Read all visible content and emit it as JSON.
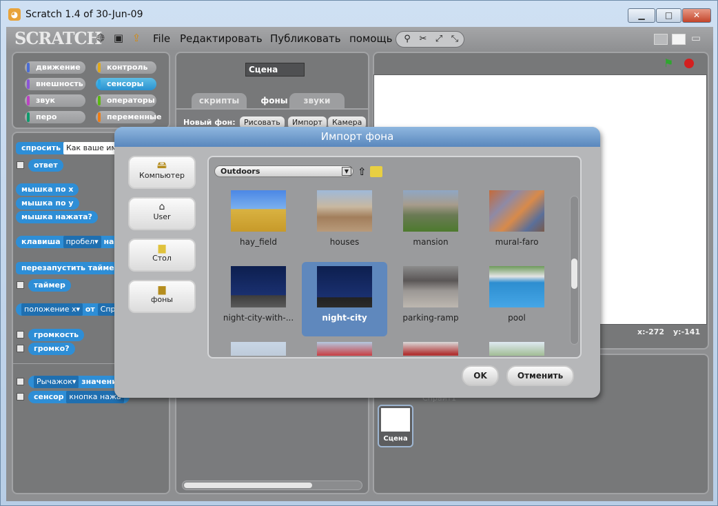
{
  "window": {
    "title": "Scratch 1.4 of 30-Jun-09",
    "minimize": "▁",
    "maximize": "□",
    "close": "✕"
  },
  "menubar": {
    "logo": "SCRATCH",
    "items": [
      "File",
      "Редактировать",
      "Публиковать",
      "помощь"
    ],
    "icons": [
      "globe-icon",
      "save-icon",
      "share-icon"
    ]
  },
  "categories": [
    {
      "label": "движение",
      "color": "#4a6cd4"
    },
    {
      "label": "контроль",
      "color": "#e1a91a"
    },
    {
      "label": "внешность",
      "color": "#8a55d7"
    },
    {
      "label": "сенсоры",
      "color": "#2ca5e2",
      "selected": true
    },
    {
      "label": "звук",
      "color": "#bb42c3"
    },
    {
      "label": "операторы",
      "color": "#5cb712"
    },
    {
      "label": "перо",
      "color": "#0e9a6c"
    },
    {
      "label": "переменные",
      "color": "#ee7d16"
    }
  ],
  "blocks": {
    "ask": "спросить",
    "ask_value": "Как ваше имя?",
    "answer": "ответ",
    "mouse_x": "мышка по x",
    "mouse_y": "мышка по y",
    "mouse_down": "мышка нажата?",
    "key": "клавиша",
    "key_value": "пробел",
    "key_suffix": "наж",
    "reset_timer": "перезапустить таймер",
    "timer": "таймер",
    "position": "положение x",
    "of": "от",
    "of_target": "Спр",
    "loudness": "громкость",
    "loud": "громко?",
    "slider": "Рычажок",
    "value": "значение",
    "sensor": "сенсор",
    "sensor_value": "кнопка нажа"
  },
  "middle": {
    "name": "Сцена",
    "tabs": [
      "скрипты",
      "фоны",
      "звуки"
    ],
    "new_bg": "Новый фон:",
    "paint": "Рисовать",
    "import": "Импорт",
    "camera": "Камера"
  },
  "stage": {
    "x_label": "x:",
    "x_value": "-272",
    "y_label": "y:",
    "y_value": "-141"
  },
  "sprites": {
    "stage_label": "Сцена",
    "sprite_name": "Спрайт1"
  },
  "dialog": {
    "title": "Импорт фона",
    "locations": [
      {
        "label": "Компьютер",
        "icon": "computer-icon"
      },
      {
        "label": "User",
        "icon": "home-icon"
      },
      {
        "label": "Стол",
        "icon": "folder-icon"
      },
      {
        "label": "фоны",
        "icon": "backgrounds-folder-icon"
      }
    ],
    "folder": "Outdoors",
    "thumbnails": [
      {
        "label": "hay_field"
      },
      {
        "label": "houses"
      },
      {
        "label": "mansion"
      },
      {
        "label": "mural-faro"
      },
      {
        "label": "night-city-with-..."
      },
      {
        "label": "night-city",
        "selected": true
      },
      {
        "label": "parking-ramp"
      },
      {
        "label": "pool"
      }
    ],
    "ok": "OK",
    "cancel": "Отменить"
  }
}
